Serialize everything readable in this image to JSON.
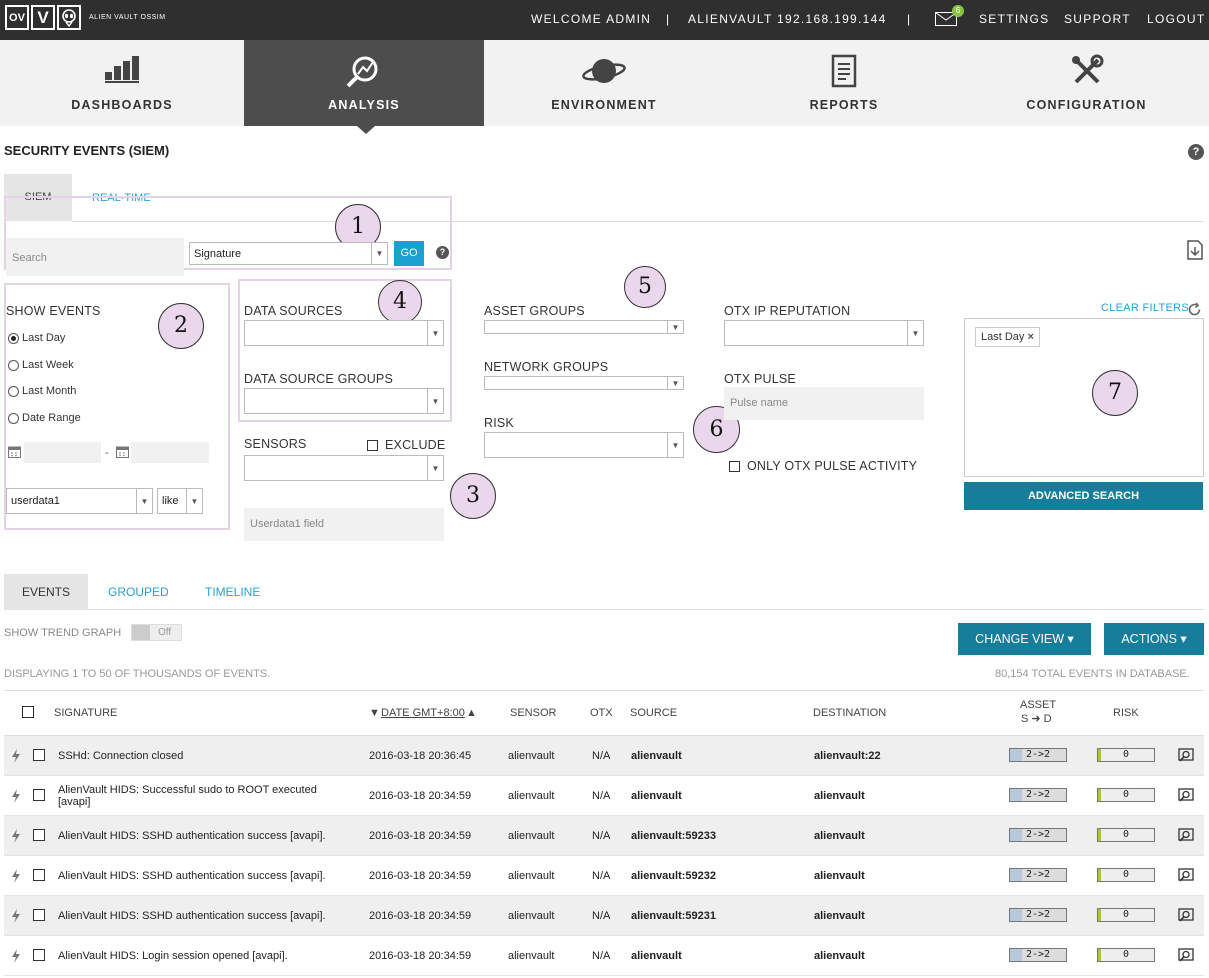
{
  "header": {
    "logo_letters": [
      "OV",
      "V",
      "ALIEN"
    ],
    "logo_text": "ALIEN VAULT OSSIM",
    "welcome": "WELCOME ADMIN",
    "sep1": "|",
    "host": "ALIENVAULT 192.168.199.144",
    "sep2": "|",
    "mail_count": "6",
    "settings": "SETTINGS",
    "support": "SUPPORT",
    "logout": "LOGOUT"
  },
  "nav": [
    {
      "label": "DASHBOARDS",
      "icon": "bar-chart-icon"
    },
    {
      "label": "ANALYSIS",
      "icon": "analysis-magnifier-icon"
    },
    {
      "label": "ENVIRONMENT",
      "icon": "planet-icon"
    },
    {
      "label": "REPORTS",
      "icon": "report-document-icon"
    },
    {
      "label": "CONFIGURATION",
      "icon": "wrench-tools-icon"
    }
  ],
  "page": {
    "title": "SECURITY EVENTS (SIEM)",
    "help": "?"
  },
  "tabs": {
    "siem": "SIEM",
    "realtime": "REAL-TIME"
  },
  "search": {
    "placeholder": "Search",
    "type": "Signature",
    "go": "GO",
    "help": "?"
  },
  "callouts": [
    "1",
    "2",
    "3",
    "4",
    "5",
    "6",
    "7"
  ],
  "show_events": {
    "title": "SHOW EVENTS",
    "options": [
      "Last Day",
      "Last Week",
      "Last Month",
      "Date Range"
    ],
    "dash": "-",
    "field": "userdata1",
    "op": "like"
  },
  "filters": {
    "data_sources": "DATA SOURCES",
    "data_source_groups": "DATA SOURCE GROUPS",
    "sensors": "SENSORS",
    "exclude": "EXCLUDE",
    "userdata_placeholder": "Userdata1 field",
    "asset_groups": "ASSET GROUPS",
    "network_groups": "NETWORK GROUPS",
    "risk": "RISK",
    "otx_ip": "OTX IP REPUTATION",
    "otx_pulse": "OTX PULSE",
    "pulse_placeholder": "Pulse name",
    "only_otx": "ONLY OTX PULSE ACTIVITY",
    "clear_filters": "CLEAR FILTERS",
    "active_filter": "Last Day",
    "remove": "×",
    "advanced_search": "ADVANCED SEARCH"
  },
  "views": {
    "events": "EVENTS",
    "grouped": "GROUPED",
    "timeline": "TIMELINE"
  },
  "trend": {
    "label": "SHOW TREND GRAPH",
    "state": "Off"
  },
  "buttons": {
    "change_view": "CHANGE VIEW ▾",
    "actions": "ACTIONS ▾"
  },
  "summary": {
    "displaying": "DISPLAYING 1 TO 50 OF THOUSANDS OF EVENTS.",
    "total": "80,154 TOTAL EVENTS IN DATABASE."
  },
  "columns": {
    "signature": "SIGNATURE",
    "date": "DATE GMT+8:00",
    "sensor": "SENSOR",
    "otx": "OTX",
    "source": "SOURCE",
    "destination": "DESTINATION",
    "asset": "ASSET",
    "asset_sub": "S ➜ D",
    "risk": "RISK"
  },
  "rows": [
    {
      "signature": "SSHd: Connection closed",
      "date": "2016-03-18 20:36:45",
      "sensor": "alienvault",
      "otx": "N/A",
      "source": "alienvault",
      "destination": "alienvault:22",
      "asset": "2->2",
      "risk": "0"
    },
    {
      "signature": "AlienVault HIDS: Successful sudo to ROOT executed [avapi]",
      "date": "2016-03-18 20:34:59",
      "sensor": "alienvault",
      "otx": "N/A",
      "source": "alienvault",
      "destination": "alienvault",
      "asset": "2->2",
      "risk": "0"
    },
    {
      "signature": "AlienVault HIDS: SSHD authentication success [avapi].",
      "date": "2016-03-18 20:34:59",
      "sensor": "alienvault",
      "otx": "N/A",
      "source": "alienvault:59233",
      "destination": "alienvault",
      "asset": "2->2",
      "risk": "0"
    },
    {
      "signature": "AlienVault HIDS: SSHD authentication success [avapi].",
      "date": "2016-03-18 20:34:59",
      "sensor": "alienvault",
      "otx": "N/A",
      "source": "alienvault:59232",
      "destination": "alienvault",
      "asset": "2->2",
      "risk": "0"
    },
    {
      "signature": "AlienVault HIDS: SSHD authentication success [avapi].",
      "date": "2016-03-18 20:34:59",
      "sensor": "alienvault",
      "otx": "N/A",
      "source": "alienvault:59231",
      "destination": "alienvault",
      "asset": "2->2",
      "risk": "0"
    },
    {
      "signature": "AlienVault HIDS: Login session opened [avapi].",
      "date": "2016-03-18 20:34:59",
      "sensor": "alienvault",
      "otx": "N/A",
      "source": "alienvault",
      "destination": "alienvault",
      "asset": "2->2",
      "risk": "0"
    }
  ]
}
